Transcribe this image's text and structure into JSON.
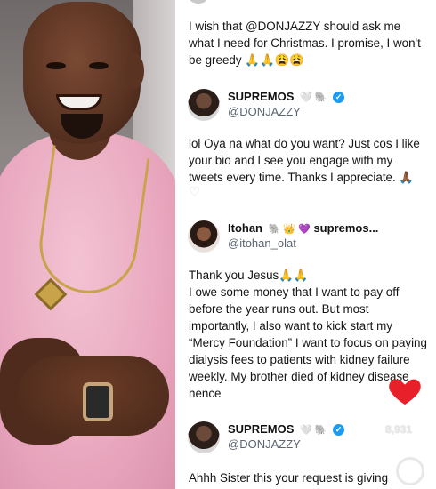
{
  "tweets": [
    {
      "text": "I wish that @DONJAZZY should ask me what I need for Christmas. I promise, I won't be greedy 🙏🙏😩😩"
    },
    {
      "author": {
        "name": "SUPREMOS",
        "name_emojis": "🤍 🐘",
        "handle": "@DONJAZZY",
        "verified": true
      },
      "text": "lol Oya na what do you want? Just cos I like your bio and I see you engage with my tweets every time. Thanks I appreciate. 🙏🏾",
      "heart": "♡"
    },
    {
      "author": {
        "name": "Itohan",
        "name_emojis": "🐘 👑 💜",
        "name_suffix": "supremos...",
        "handle": "@itohan_olat"
      },
      "text_lines": [
        "Thank you Jesus🙏🙏",
        "I owe some money that I want to pay off before the year runs out. But most importantly, I also want to kick start my “Mercy Foundation” I want to focus on paying dialysis fees to patients with kidney failure weekly. My brother died of kidney disease hence"
      ]
    },
    {
      "author": {
        "name": "SUPREMOS",
        "name_emojis": "🤍 🐘",
        "handle": "@DONJAZZY",
        "verified": true
      },
      "text": "Ahhh Sister this your request is giving"
    }
  ],
  "overlay": {
    "like_count": "8,931",
    "heart_color": "#e8202a"
  },
  "photo": {
    "shirt_color": "#efb6c9",
    "accessory": "gold-chain-pendant",
    "watch": "smart-watch"
  },
  "colors": {
    "verified": "#1d9bf0",
    "handle": "#5b6470",
    "text": "#141414"
  }
}
